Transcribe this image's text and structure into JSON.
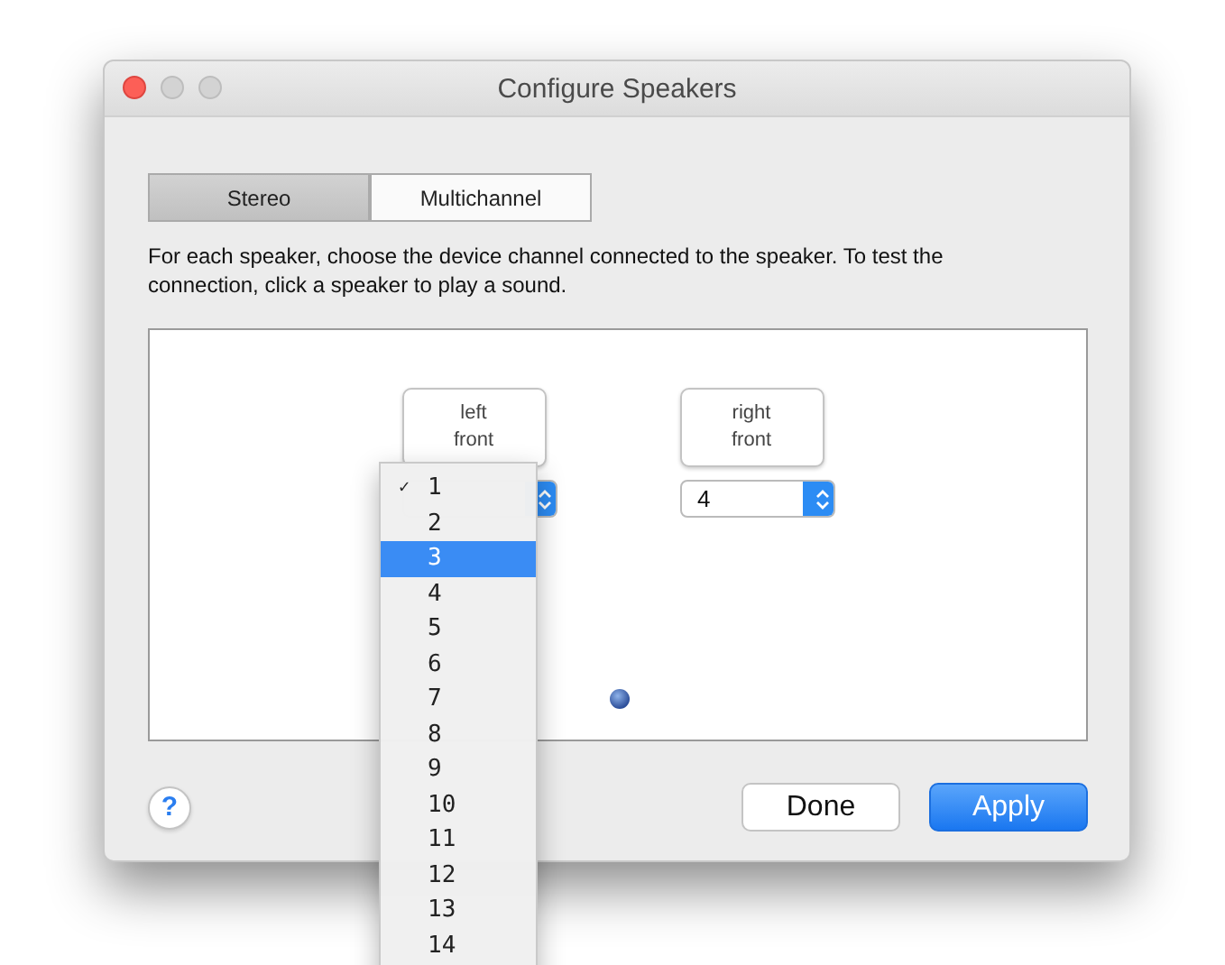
{
  "window": {
    "title": "Configure Speakers"
  },
  "tabs": [
    {
      "label": "Stereo",
      "selected": true
    },
    {
      "label": "Multichannel",
      "selected": false
    }
  ],
  "description": "For each speaker, choose the device channel connected to the speaker. To test the connection, click a speaker to play a sound.",
  "speakers": [
    {
      "label": "left\nfront"
    },
    {
      "label": "right\nfront",
      "channel": "4"
    }
  ],
  "channel_menu": [
    {
      "label": "1",
      "checked": true,
      "selected": false
    },
    {
      "label": "2",
      "checked": false,
      "selected": false
    },
    {
      "label": "3",
      "checked": false,
      "selected": true
    },
    {
      "label": "4",
      "checked": false,
      "selected": false
    },
    {
      "label": "5",
      "checked": false,
      "selected": false
    },
    {
      "label": "6",
      "checked": false,
      "selected": false
    },
    {
      "label": "7",
      "checked": false,
      "selected": false
    },
    {
      "label": "8",
      "checked": false,
      "selected": false
    },
    {
      "label": "9",
      "checked": false,
      "selected": false
    },
    {
      "label": "10",
      "checked": false,
      "selected": false
    },
    {
      "label": "11",
      "checked": false,
      "selected": false
    },
    {
      "label": "12",
      "checked": false,
      "selected": false
    },
    {
      "label": "13",
      "checked": false,
      "selected": false
    },
    {
      "label": "14",
      "checked": false,
      "selected": false
    }
  ],
  "check_mark": "✓",
  "help": "?",
  "buttons": [
    {
      "label": "Done",
      "kind": "normal"
    },
    {
      "label": "Apply",
      "kind": "default"
    }
  ]
}
